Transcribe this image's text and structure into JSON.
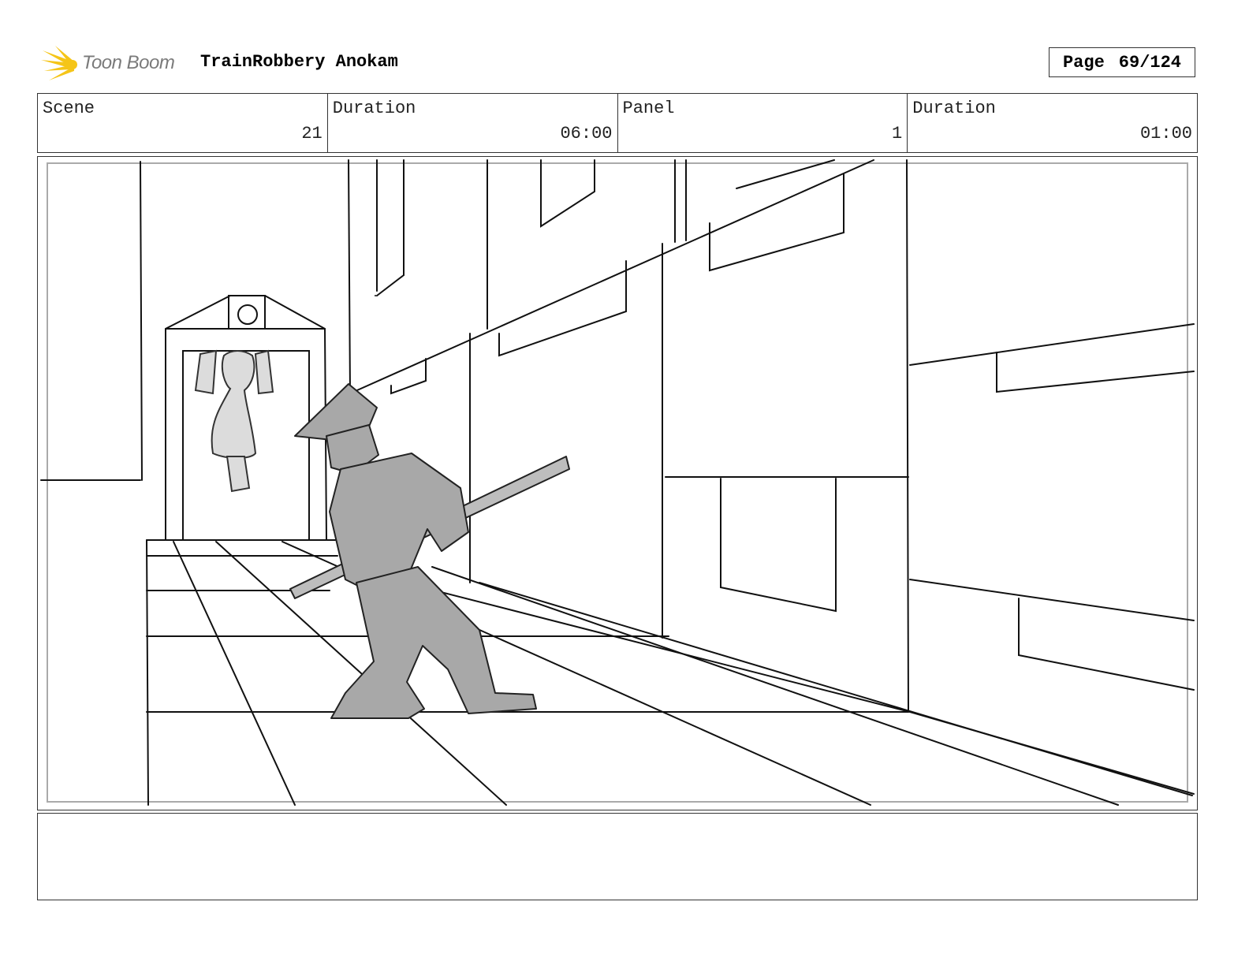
{
  "header": {
    "logo_text": "Toon Boom",
    "project_title": "TrainRobbery Anokam",
    "page_label": "Page",
    "page_number": "69/124"
  },
  "info": {
    "scene_label": "Scene",
    "scene_value": "21",
    "scene_duration_label": "Duration",
    "scene_duration_value": "06:00",
    "panel_label": "Panel",
    "panel_value": "1",
    "panel_duration_label": "Duration",
    "panel_duration_value": "01:00"
  },
  "notes": {
    "text": ""
  },
  "colors": {
    "logo_yellow": "#f5c518",
    "logo_gray": "#7a7a7a",
    "sketch_gray": "#a8a8a8"
  }
}
